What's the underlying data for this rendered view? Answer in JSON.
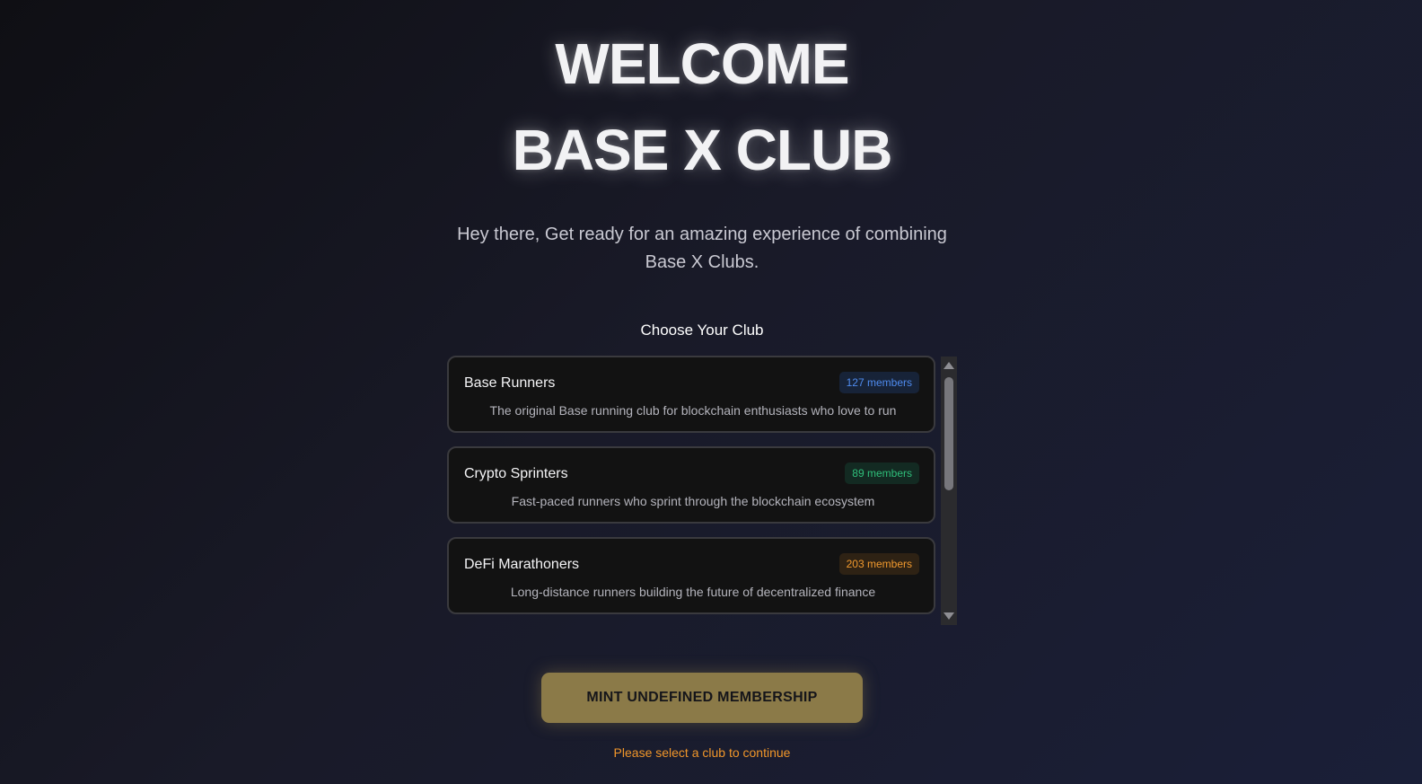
{
  "hero": {
    "line1": "WELCOME",
    "line2": "BASE X CLUB"
  },
  "subtitle": "Hey there, Get ready for an amazing experience of combining Base X Clubs.",
  "club_section": {
    "label": "Choose Your Club",
    "clubs": [
      {
        "name": "Base Runners",
        "members": "127 members",
        "description": "The original Base running club for blockchain enthusiasts who love to run",
        "badge_color": "#4f8cf0"
      },
      {
        "name": "Crypto Sprinters",
        "members": "89 members",
        "description": "Fast-paced runners who sprint through the blockchain ecosystem",
        "badge_color": "#2fbf7a"
      },
      {
        "name": "DeFi Marathoners",
        "members": "203 members",
        "description": "Long-distance runners building the future of decentralized finance",
        "badge_color": "#f29a2e"
      }
    ]
  },
  "mint_button": {
    "label": "MINT UNDEFINED MEMBERSHIP"
  },
  "status": {
    "message": "Please select a club to continue",
    "color": "#f0962a"
  },
  "colors": {
    "accent": "#8b7a48",
    "background": "#191a28"
  }
}
